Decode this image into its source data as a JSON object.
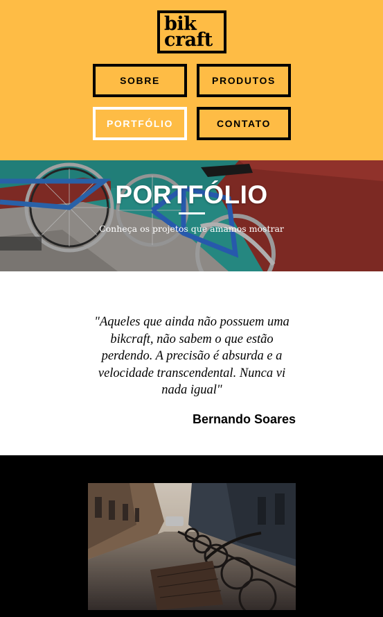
{
  "header": {
    "logo": {
      "line1": "bik",
      "line2": "craft"
    },
    "nav": [
      {
        "label": "SOBRE",
        "active": false
      },
      {
        "label": "PRODUTOS",
        "active": false
      },
      {
        "label": "PORTFÓLIO",
        "active": true
      },
      {
        "label": "CONTATO",
        "active": false
      }
    ],
    "colors": {
      "background": "#FEBC45",
      "border": "#000000",
      "active": "#FFFFFF"
    }
  },
  "hero": {
    "title": "PORTFÓLIO",
    "subtitle": "Conheça os projetos que amamos mostrar"
  },
  "quote": {
    "text": "\"Aqueles que ainda não possuem uma bikcraft, não sabem o que estão perdendo. A precisão é absurda e a velocidade transcendental. Nunca vi nada igual\"",
    "author": "Bernando Soares"
  },
  "gallery": {
    "background": "#000000"
  }
}
